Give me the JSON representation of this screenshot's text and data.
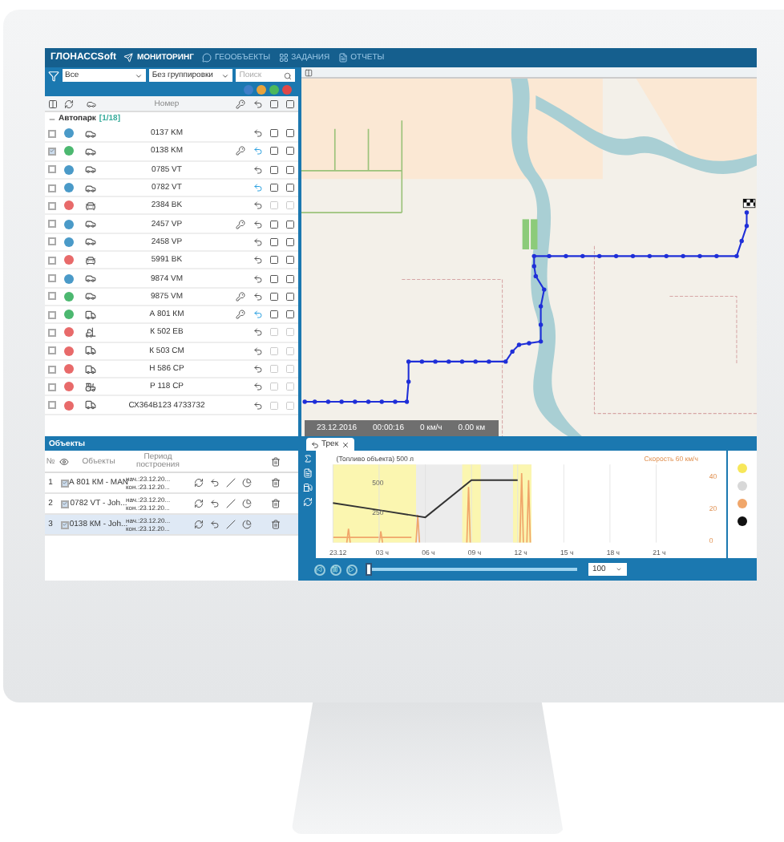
{
  "nav": {
    "logo": "ГЛОНАССSoft",
    "items": [
      {
        "label": "МОНИТОРИНГ",
        "selected": true,
        "kind": "monitor"
      },
      {
        "label": "ГЕООБЪЕКТЫ",
        "selected": false,
        "kind": "geo"
      },
      {
        "label": "ЗАДАНИЯ",
        "selected": false,
        "kind": "tasks"
      },
      {
        "label": "ОТЧЕТЫ",
        "selected": false,
        "kind": "reports"
      }
    ]
  },
  "filters": {
    "status": "Все",
    "grouping": "Без группировки",
    "search": {
      "placeholder": "Поиск"
    }
  },
  "status_dots": [
    {
      "color": "#3f7fc8"
    },
    {
      "color": "#e8a33c"
    },
    {
      "color": "#4cb85c"
    },
    {
      "color": "#e04848"
    }
  ],
  "vehicle_table": {
    "number_column": "Номер",
    "group": {
      "name": "Автопарк",
      "count": "[1/18]",
      "expanded": true
    },
    "rows": [
      {
        "checked": false,
        "color": "#4a9ac8",
        "kind": "car",
        "number": "0137 KM",
        "key": false,
        "track_on": false,
        "enabled": true
      },
      {
        "checked": true,
        "color": "#4cb870",
        "kind": "car",
        "number": "0138 KM",
        "key": true,
        "track_on": true,
        "enabled": true
      },
      {
        "checked": false,
        "color": "#4a9ac8",
        "kind": "car",
        "number": "0785 VT",
        "key": false,
        "track_on": false,
        "enabled": true
      },
      {
        "checked": false,
        "color": "#4a9ac8",
        "kind": "car",
        "number": "0782 VT",
        "key": false,
        "track_on": true,
        "enabled": true
      },
      {
        "checked": false,
        "color": "#e86a6a",
        "kind": "sedan",
        "number": "2384 BK",
        "key": false,
        "track_on": false,
        "enabled": false
      },
      {
        "checked": false,
        "color": "#4a9ac8",
        "kind": "car",
        "number": "2457 VP",
        "key": true,
        "track_on": false,
        "enabled": true
      },
      {
        "checked": false,
        "color": "#4a9ac8",
        "kind": "car",
        "number": "2458 VP",
        "key": false,
        "track_on": false,
        "enabled": true
      },
      {
        "checked": false,
        "color": "#e86a6a",
        "kind": "sedan",
        "number": "5991 BK",
        "key": false,
        "track_on": false,
        "enabled": true
      },
      {
        "checked": false,
        "color": "#4a9ac8",
        "kind": "car",
        "number": "9874 VM",
        "key": false,
        "track_on": false,
        "enabled": true
      },
      {
        "checked": false,
        "color": "#4cb870",
        "kind": "car",
        "number": "9875 VM",
        "key": true,
        "track_on": false,
        "enabled": true
      },
      {
        "checked": false,
        "color": "#4cb870",
        "kind": "truck",
        "number": "А 801 КМ",
        "key": true,
        "track_on": true,
        "enabled": true
      },
      {
        "checked": false,
        "color": "#e86a6a",
        "kind": "loader",
        "number": "К 502 ЕВ",
        "key": false,
        "track_on": false,
        "enabled": false
      },
      {
        "checked": false,
        "color": "#e86a6a",
        "kind": "truck",
        "number": "К 503 СМ",
        "key": false,
        "track_on": false,
        "enabled": false
      },
      {
        "checked": false,
        "color": "#e86a6a",
        "kind": "truck",
        "number": "Н 586 СР",
        "key": false,
        "track_on": false,
        "enabled": false
      },
      {
        "checked": false,
        "color": "#e86a6a",
        "kind": "tractor",
        "number": "Р 118 СР",
        "key": false,
        "track_on": false,
        "enabled": false
      },
      {
        "checked": false,
        "color": "#e86a6a",
        "kind": "truck",
        "number": "СХ364В123 4733732",
        "key": false,
        "track_on": false,
        "enabled": false
      }
    ]
  },
  "map": {
    "info": [
      "23.12.2016",
      "00:00:16",
      "0 км/ч",
      "0.00 км"
    ]
  },
  "objects": {
    "title": "Объекты",
    "columns": {
      "num": "№",
      "name": "Объекты",
      "period": "Период построения"
    },
    "rows": [
      {
        "num": "1",
        "checked": true,
        "name": "А 801 КМ - MAN",
        "start": "нач.:23.12.20...",
        "end": "кон.:23.12.20...",
        "selected": false
      },
      {
        "num": "2",
        "checked": true,
        "name": "0782 VT - Joh...",
        "start": "нач.:23.12.20...",
        "end": "кон.:23.12.20...",
        "selected": false
      },
      {
        "num": "3",
        "checked": true,
        "name": "0138 КМ - Joh...",
        "start": "нач.:23.12.20...",
        "end": "кон.:23.12.20...",
        "selected": true
      }
    ]
  },
  "track": {
    "tab": "Трек",
    "chart_title": "(Топливо объекта) 500 л",
    "speed_label": "Скорость 60 км/ч",
    "right_ticks": [
      "40",
      "20",
      "0"
    ],
    "chart_data": {
      "type": "line",
      "categories": [
        "23.12",
        "03 ч",
        "06 ч",
        "09 ч",
        "12 ч",
        "15 ч",
        "18 ч",
        "21 ч"
      ],
      "ylim": [
        0,
        650
      ],
      "yticks": [
        250,
        500
      ],
      "grid": true,
      "series": [
        {
          "color": "#333333",
          "values": [
            330,
            270,
            210,
            520,
            520,
            null,
            null,
            null
          ]
        }
      ]
    },
    "legend": [
      {
        "color": "#f7e75a"
      },
      {
        "color": "#d8d8d8"
      },
      {
        "color": "#f0a66a"
      },
      {
        "color": "#111111"
      }
    ],
    "playback": {
      "level": 0,
      "speed": "100"
    }
  }
}
